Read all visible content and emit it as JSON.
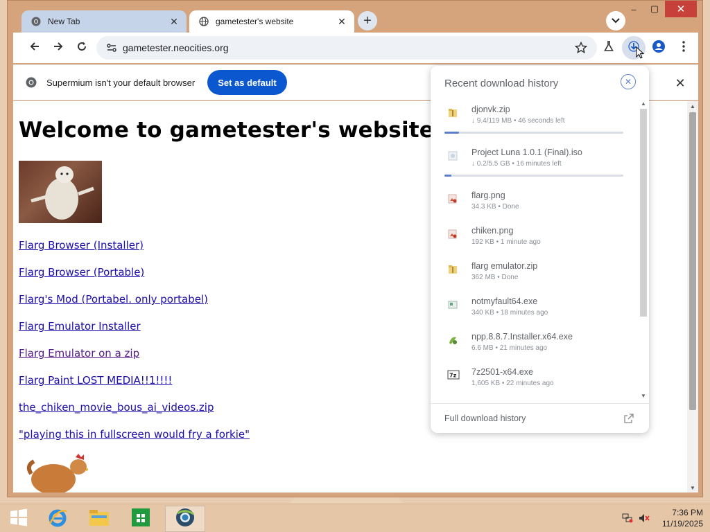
{
  "tabs": [
    {
      "title": "New Tab"
    },
    {
      "title": "gametester's website"
    }
  ],
  "toolbar": {
    "url": "gametester.neocities.org"
  },
  "infobar": {
    "message": "Supermium isn't your default browser",
    "button": "Set as default"
  },
  "page": {
    "heading": "Welcome to gametester's website",
    "links": [
      {
        "text": "Flarg Browser (Installer)",
        "visited": false
      },
      {
        "text": "Flarg Browser (Portable)",
        "visited": false
      },
      {
        "text": "Flarg's Mod (Portabel. only portabel)",
        "visited": false
      },
      {
        "text": "Flarg Emulator Installer",
        "visited": false
      },
      {
        "text": "Flarg Emulator on a zip",
        "visited": true
      },
      {
        "text": "Flarg Paint LOST MEDIA!!1!!!!",
        "visited": false
      },
      {
        "text": "the_chiken_movie_bous_ai_videos.zip",
        "visited": false
      },
      {
        "text": "\"playing this in fullscreen would fry a forkie\"",
        "visited": false
      }
    ]
  },
  "downloads": {
    "header": "Recent download history",
    "footer": "Full download history",
    "items": [
      {
        "name": "djonvk.zip",
        "status": "↓ 9.4/119 MB • 46 seconds left",
        "icon": "zip-folder-icon",
        "progress": 0.08
      },
      {
        "name": "Project Luna 1.0.1 (Final).iso",
        "status": "↓ 0.2/5.5 GB • 16 minutes left",
        "icon": "disc-image-icon",
        "progress": 0.04
      },
      {
        "name": "flarg.png",
        "status": "34.3 KB • Done",
        "icon": "image-file-icon"
      },
      {
        "name": "chiken.png",
        "status": "192 KB • 1 minute ago",
        "icon": "image-file-icon"
      },
      {
        "name": "flarg emulator.zip",
        "status": "362 MB • Done",
        "icon": "zip-folder-icon"
      },
      {
        "name": "notmyfault64.exe",
        "status": "340 KB • 18 minutes ago",
        "icon": "exe-file-icon"
      },
      {
        "name": "npp.8.8.7.Installer.x64.exe",
        "status": "6.6 MB • 21 minutes ago",
        "icon": "installer-icon"
      },
      {
        "name": "7z2501-x64.exe",
        "status": "1,605 KB • 22 minutes ago",
        "icon": "7zip-icon"
      }
    ]
  },
  "taskbar": {
    "time": "7:36 PM",
    "date": "11/19/2025"
  }
}
